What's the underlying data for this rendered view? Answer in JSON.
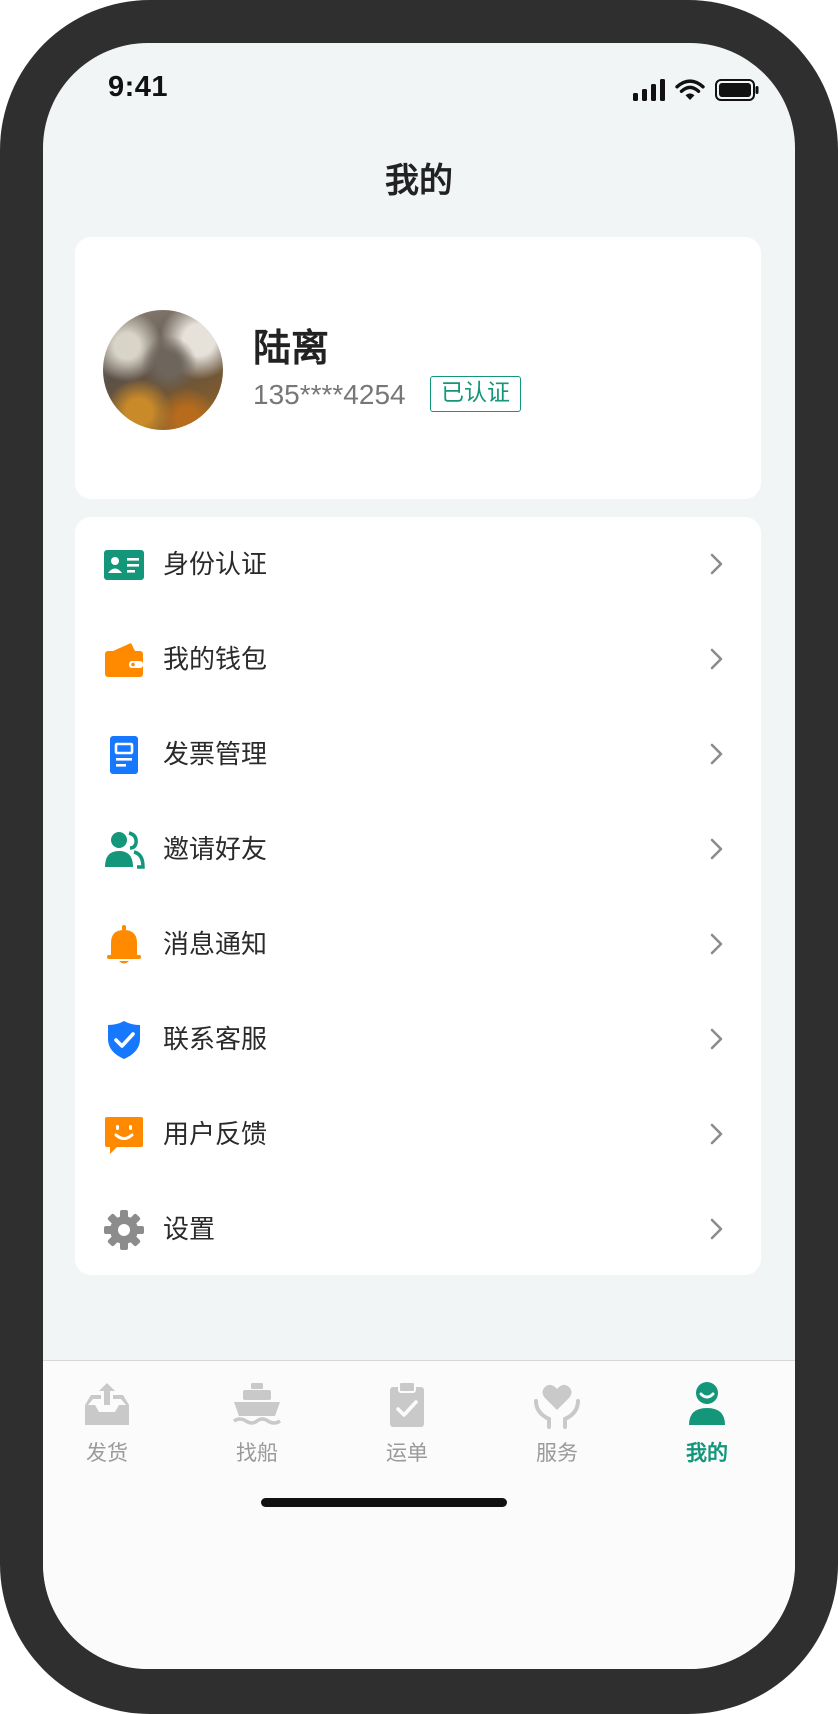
{
  "status_bar": {
    "time": "9:41"
  },
  "header": {
    "title": "我的"
  },
  "profile": {
    "name": "陆离",
    "phone": "135****4254",
    "badge": "已认证"
  },
  "menu": {
    "items": [
      {
        "label": "身份认证",
        "icon": "id-card-icon",
        "color": "#13967a"
      },
      {
        "label": "我的钱包",
        "icon": "wallet-icon",
        "color": "#ff8a00"
      },
      {
        "label": "发票管理",
        "icon": "invoice-icon",
        "color": "#1677ff"
      },
      {
        "label": "邀请好友",
        "icon": "users-icon",
        "color": "#13967a"
      },
      {
        "label": "消息通知",
        "icon": "bell-icon",
        "color": "#ff8a00"
      },
      {
        "label": "联系客服",
        "icon": "shield-check-icon",
        "color": "#1677ff"
      },
      {
        "label": "用户反馈",
        "icon": "feedback-icon",
        "color": "#ff8a00"
      },
      {
        "label": "设置",
        "icon": "gear-icon",
        "color": "#8c8c8c"
      }
    ]
  },
  "tab_bar": {
    "tabs": [
      {
        "label": "发货",
        "icon": "tray-upload-icon",
        "active": false
      },
      {
        "label": "找船",
        "icon": "ship-icon",
        "active": false
      },
      {
        "label": "运单",
        "icon": "clipboard-check-icon",
        "active": false
      },
      {
        "label": "服务",
        "icon": "heart-hands-icon",
        "active": false
      },
      {
        "label": "我的",
        "icon": "person-icon",
        "active": true
      }
    ]
  },
  "colors": {
    "accent": "#13967a",
    "background": "#f1f5f6"
  }
}
